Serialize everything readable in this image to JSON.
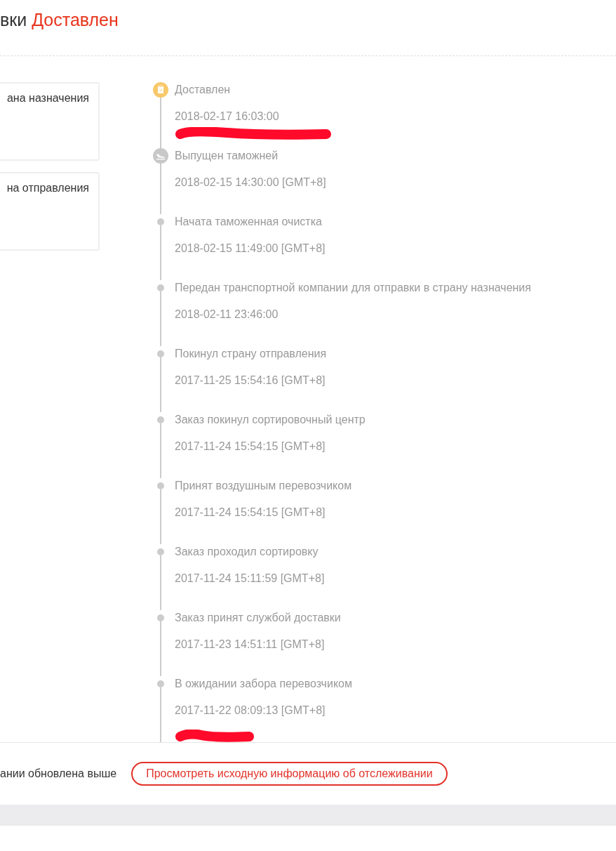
{
  "header": {
    "title_prefix": "вки",
    "status": "Доставлен"
  },
  "address_cards": [
    {
      "label": "ана назначения"
    },
    {
      "label": "на отправления"
    }
  ],
  "events": [
    {
      "kind": "delivered",
      "title": "Доставлен",
      "time": "2018-02-17 16:03:00",
      "redacted": true
    },
    {
      "kind": "customs",
      "title": "Выпущен таможней",
      "time": "2018-02-15 14:30:00 [GMT+8]",
      "redacted": false
    },
    {
      "kind": "dot",
      "title": "Начата таможенная очистка",
      "time": "2018-02-15 11:49:00 [GMT+8]",
      "redacted": false
    },
    {
      "kind": "dot",
      "title": "Передан транспортной компании для отправки в страну назначения",
      "time": "2018-02-11 23:46:00",
      "redacted": false
    },
    {
      "kind": "dot",
      "title": "Покинул страну отправления",
      "time": "2017-11-25 15:54:16 [GMT+8]",
      "redacted": false
    },
    {
      "kind": "dot",
      "title": "Заказ покинул сортировочный центр",
      "time": "2017-11-24 15:54:15 [GMT+8]",
      "redacted": false
    },
    {
      "kind": "dot",
      "title": "Принят воздушным перевозчиком",
      "time": "2017-11-24 15:54:15 [GMT+8]",
      "redacted": false
    },
    {
      "kind": "dot",
      "title": "Заказ проходил сортировку",
      "time": "2017-11-24 15:11:59 [GMT+8]",
      "redacted": false
    },
    {
      "kind": "dot",
      "title": "Заказ принят службой доставки",
      "time": "2017-11-23 14:51:11 [GMT+8]",
      "redacted": false
    },
    {
      "kind": "dot",
      "title": "В ожидании забора перевозчиком",
      "time": "2017-11-22 08:09:13 [GMT+8]",
      "redacted": true
    }
  ],
  "footer": {
    "note": "ании обновлена выше",
    "button": "Просмотреть исходную информацию об отслеживании"
  }
}
